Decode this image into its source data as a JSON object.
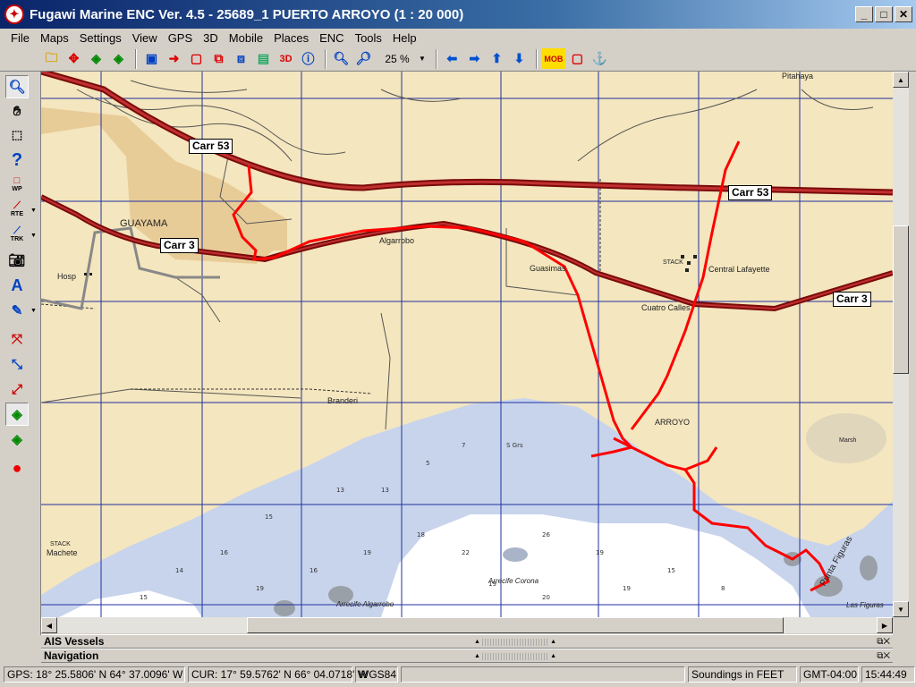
{
  "window": {
    "title": "Fugawi Marine ENC Ver. 4.5 - 25689_1  PUERTO ARROYO  (1 : 20 000)",
    "app_icon": "compass-logo-icon",
    "controls": [
      "minimize-icon",
      "maximize-icon",
      "close-icon"
    ]
  },
  "menu": {
    "items": [
      "File",
      "Maps",
      "Settings",
      "View",
      "GPS",
      "3D",
      "Mobile",
      "Places",
      "ENC",
      "Tools",
      "Help"
    ]
  },
  "toolbar": {
    "zoom_value": "25 %",
    "buttons": [
      "open-folder-icon",
      "move-map-icon",
      "map-layers-icon",
      "map-layers-alt-icon",
      "map-window-icon",
      "route-arrow-icon",
      "frame-icon",
      "frame-track-icon",
      "frame-fit-icon",
      "chart-image-icon",
      "3d-view-icon",
      "info-icon",
      "zoom-out-icon",
      "zoom-in-icon",
      "pan-left-icon",
      "pan-right-icon",
      "pan-up-icon",
      "pan-down-icon",
      "man-overboard-icon",
      "mark-icon",
      "anchor-icon"
    ],
    "mob_label": "MOB",
    "threed_label": "3D"
  },
  "left_tools": {
    "wp_label": "WP",
    "rte_label": "RTE",
    "trk_label": "TRK",
    "items": [
      "zoom-tool-icon",
      "hand-tool-icon",
      "select-rect-icon",
      "help-icon",
      "waypoint-icon",
      "route-icon",
      "track-icon",
      "camera-icon",
      "compass-icon",
      "pencil-icon",
      "goto-waypoint-icon",
      "follow-route-icon",
      "reverse-route-icon",
      "track-layer-icon",
      "map-layer-icon",
      "gps-position-icon"
    ]
  },
  "map": {
    "road_labels": [
      "Carr 53",
      "Carr 53",
      "Carr 3",
      "Carr 3"
    ],
    "place_labels": {
      "guayama": "GUAYAMA",
      "algarrobo": "Algarrobo",
      "guasimas": "Guasimas",
      "central_lafayette": "Central Lafayette",
      "stack_1": "STACK",
      "cuatro_calles": "Cuatro Calles",
      "branderi": "Branderi",
      "arroyo": "ARROYO",
      "machete": "Machete",
      "stack_2": "STACK",
      "arrecife_corona": "Arrecife Corona",
      "arrecife_algarrobo": "Arrecife Algarrobo",
      "punta_figuras": "Punta Figuras",
      "las_figuras": "Las Figuras",
      "marsh": "Marsh",
      "pitahaya": "Pitahaya",
      "hosp": "Hosp"
    },
    "colors": {
      "land": "#f4e6be",
      "urban": "#e8cc98",
      "water": "#c8d4ec",
      "shallow": "#ffffff",
      "highway": "#7a0a0a",
      "track": "#ff0000"
    }
  },
  "panels": {
    "ais": "AIS Vessels",
    "navigation": "Navigation"
  },
  "status": {
    "gps": "GPS: 18° 25.5806' N 64° 37.0096' W",
    "gps_indicator": "green",
    "cursor": "CUR: 17° 59.5762' N 66° 04.0718' W",
    "datum": "WGS84",
    "soundings": "Soundings in FEET",
    "timezone": "GMT-04:00",
    "time": "15:44:49"
  }
}
